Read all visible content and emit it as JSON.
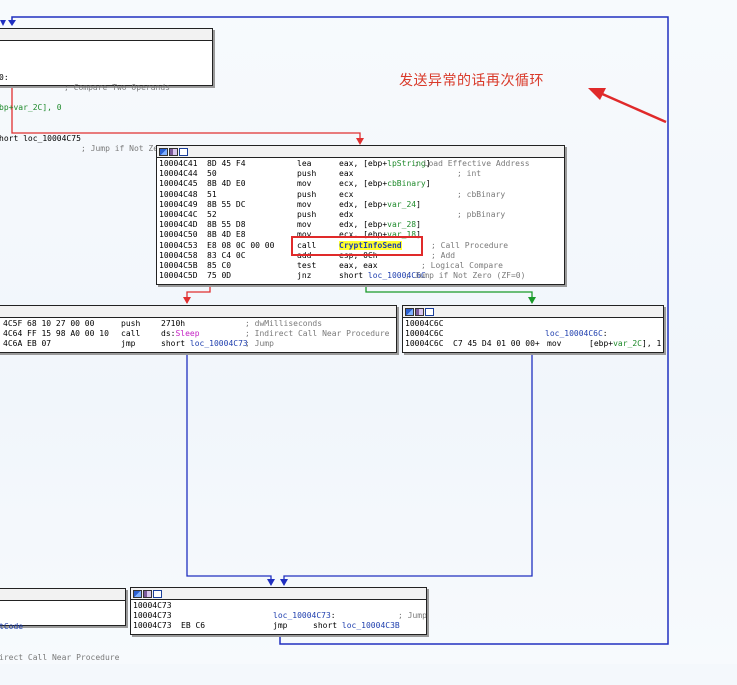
{
  "annotation": {
    "text": "发送异常的话再次循环",
    "color": "#d93a2a"
  },
  "colors": {
    "red_edge": "#e03030",
    "green_edge": "#1a9a2a",
    "blue_edge": "#2030c0",
    "highlight": "#ffff2e"
  },
  "nodes": {
    "top_left": {
      "rows": [
        {
          "op": "0:",
          "cm": "; Compare Two Operands"
        },
        {
          "op": "bp+var_2C], 0",
          "cm": ""
        },
        {
          "op": "hort loc_10004C75",
          "cm": "; Jump if Not Zero (ZF=0)"
        }
      ]
    },
    "main": {
      "rows": [
        {
          "addr": "10004C41",
          "bytes": "8D 45 F4",
          "mn": "lea",
          "op": "eax, [ebp+lpString]",
          "cm": "; Load Effective Address"
        },
        {
          "addr": "10004C44",
          "bytes": "50",
          "mn": "push",
          "op": "eax",
          "cm": "; int"
        },
        {
          "addr": "10004C45",
          "bytes": "8B 4D E0",
          "mn": "mov",
          "op": "ecx, [ebp+cbBinary]",
          "cm": ""
        },
        {
          "addr": "10004C48",
          "bytes": "51",
          "mn": "push",
          "op": "ecx",
          "cm": "; cbBinary"
        },
        {
          "addr": "10004C49",
          "bytes": "8B 55 DC",
          "mn": "mov",
          "op": "edx, [ebp+var_24]",
          "cm": ""
        },
        {
          "addr": "10004C4C",
          "bytes": "52",
          "mn": "push",
          "op": "edx",
          "cm": "; pbBinary"
        },
        {
          "addr": "10004C4D",
          "bytes": "8B 55 D8",
          "mn": "mov",
          "op": "edx, [ebp+var_28]",
          "cm": ""
        },
        {
          "addr": "10004C50",
          "bytes": "8B 4D E8",
          "mn": "mov",
          "op": "ecx, [ebp+var_18]",
          "cm": ""
        },
        {
          "addr": "10004C53",
          "bytes": "E8 08 0C 00 00",
          "mn": "call",
          "op": "CryptInfoSend",
          "cm": "; Call Procedure"
        },
        {
          "addr": "10004C58",
          "bytes": "83 C4 0C",
          "mn": "add",
          "op": "esp, 0Ch",
          "cm": "; Add"
        },
        {
          "addr": "10004C5B",
          "bytes": "85 C0",
          "mn": "test",
          "op": "eax, eax",
          "cm": "; Logical Compare"
        },
        {
          "addr": "10004C5D",
          "bytes": "75 0D",
          "mn": "jnz",
          "op": "short loc_10004C6C",
          "cm": "; Jump if Not Zero (ZF=0)"
        }
      ]
    },
    "left_mid": {
      "rows": [
        {
          "addr": "4C5F",
          "bytes": "68 10 27 00 00",
          "mn": "push",
          "op": "2710h",
          "cm": "; dwMilliseconds"
        },
        {
          "addr": "4C64",
          "bytes": "FF 15 98 A0 00 10",
          "mn": "call",
          "op": "ds:Sleep",
          "cm": "; Indirect Call Near Procedure"
        },
        {
          "addr": "4C6A",
          "bytes": "EB 07",
          "mn": "jmp",
          "op": "short loc_10004C73",
          "cm": "; Jump"
        }
      ]
    },
    "right_mid": {
      "rows": [
        {
          "addr": "10004C6C",
          "bytes": "",
          "mn": "",
          "op": "",
          "cm": ""
        },
        {
          "addr": "10004C6C",
          "bytes": "",
          "mn": "",
          "op": "loc_10004C6C:",
          "cm": ""
        },
        {
          "addr": "10004C6C",
          "bytes": "C7 45 D4 01 00 00+",
          "mn": "mov",
          "op": "[ebp+var_2C], 1",
          "cm": ""
        }
      ]
    },
    "bottom_left": {
      "rows": [
        {
          "op": "tCode"
        },
        {
          "op": "irect Call Near Procedure"
        }
      ]
    },
    "bottom": {
      "rows": [
        {
          "addr": "10004C73",
          "bytes": "",
          "mn": "",
          "op": "",
          "cm": ""
        },
        {
          "addr": "10004C73",
          "bytes": "",
          "mn": "",
          "op": "loc_10004C73:",
          "cm": "; Jump"
        },
        {
          "addr": "10004C73",
          "bytes": "EB C6",
          "mn": "jmp",
          "op": "short loc_10004C3B",
          "cm": ""
        }
      ]
    }
  }
}
